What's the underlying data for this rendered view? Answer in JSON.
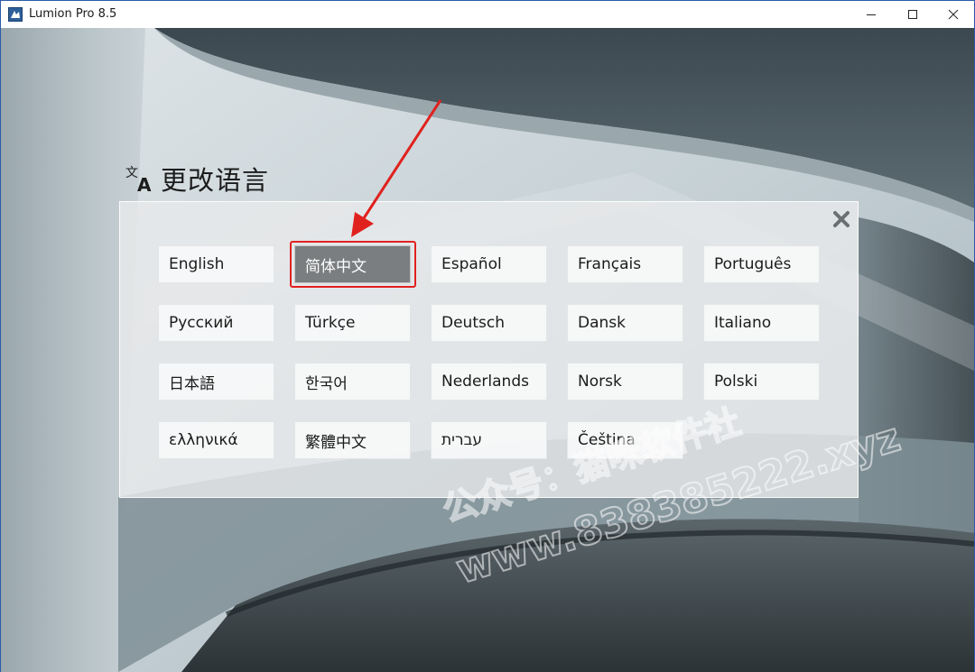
{
  "window": {
    "title": "Lumion Pro 8.5",
    "minimize_symbol": "─",
    "maximize_symbol": "☐",
    "close_symbol": "✕"
  },
  "heading": {
    "icon": "translate-icon",
    "text": "更改语言"
  },
  "dialog": {
    "close_icon": "close-icon",
    "selected_language": "简体中文",
    "languages": [
      "English",
      "简体中文",
      "Español",
      "Français",
      "Português",
      "Русский",
      "Türkçe",
      "Deutsch",
      "Dansk",
      "Italiano",
      "日本語",
      "한국어",
      "Nederlands",
      "Norsk",
      "Polski",
      "ελληνικά",
      "繁體中文",
      "עברית",
      "Čeština"
    ]
  },
  "annotation": {
    "arrow_color": "#e0221f",
    "highlight_color": "#e0221f"
  },
  "watermark": {
    "line1": "公众号：猫咪软件社",
    "line2": "www.838385222.xyz"
  }
}
